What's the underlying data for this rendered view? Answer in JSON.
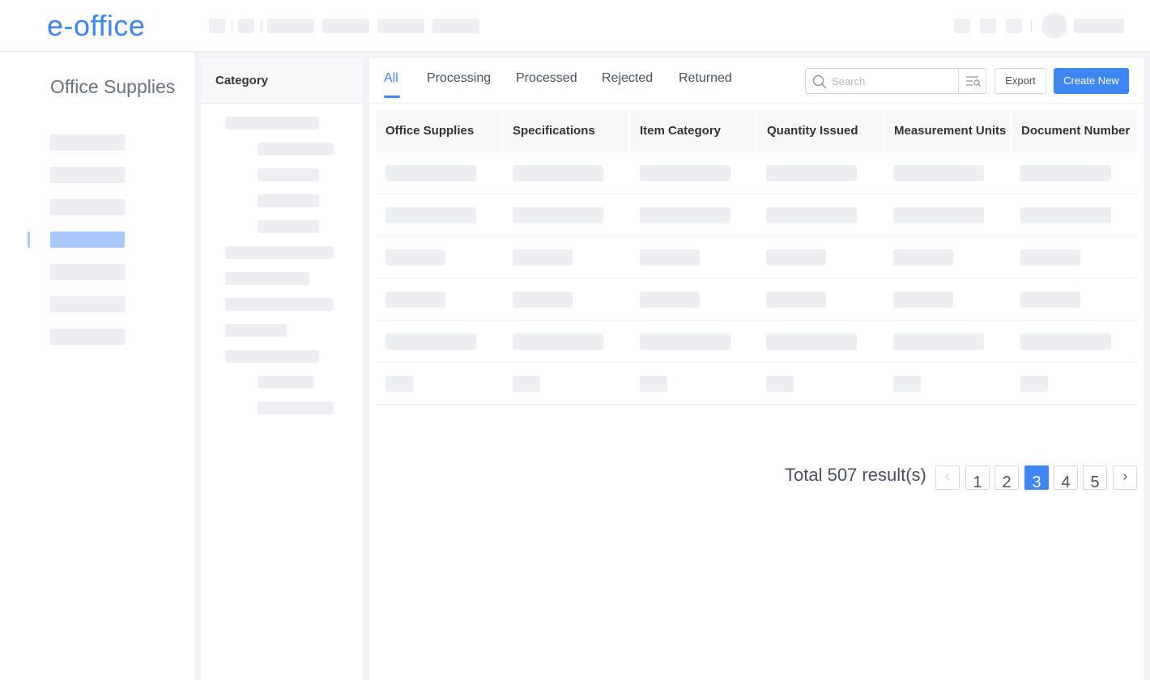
{
  "app": {
    "logo": "e-office"
  },
  "sidebar": {
    "title": "Office Supplies"
  },
  "category": {
    "title": "Category"
  },
  "tabs": [
    {
      "label": "All",
      "active": true
    },
    {
      "label": "Processing"
    },
    {
      "label": "Processed"
    },
    {
      "label": "Rejected"
    },
    {
      "label": "Returned"
    }
  ],
  "toolbar": {
    "search_placeholder": "Search",
    "export_label": "Export",
    "create_label": "Create New"
  },
  "table": {
    "columns": [
      "Office Supplies",
      "Specifications",
      "Item Category",
      "Quantity Issued",
      "Measurement Units",
      "Document Number"
    ]
  },
  "pagination": {
    "total_text": "Total 507 result(s)",
    "pages": [
      "1",
      "2",
      "3",
      "4",
      "5"
    ],
    "current": "3",
    "prev_icon": "chevron-left-icon",
    "next_icon": "chevron-right-icon"
  },
  "colors": {
    "accent": "#3d86f4",
    "placeholder": "#eceef2",
    "active_placeholder": "#a9c8fb"
  }
}
